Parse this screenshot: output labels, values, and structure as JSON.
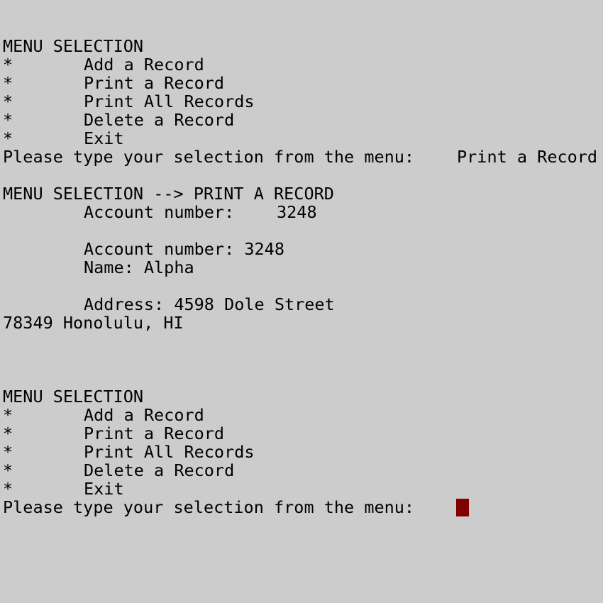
{
  "session1": {
    "menu_title": "MENU SELECTION",
    "bullet": "*",
    "options": [
      "Add a Record",
      "Print a Record",
      "Print All Records",
      "Delete a Record",
      "Exit"
    ],
    "prompt": "Please type your selection from the menu:",
    "user_input": "Print a Record"
  },
  "print_record": {
    "header": "MENU SELECTION --> PRINT A RECORD",
    "account_prompt": "Account number:",
    "account_input": "3248",
    "account_line": "Account number: 3248",
    "name_line": "Name: Alpha",
    "address_line": "Address: 4598 Dole Street",
    "city_line": "78349 Honolulu, HI"
  },
  "session2": {
    "menu_title": "MENU SELECTION",
    "bullet": "*",
    "options": [
      "Add a Record",
      "Print a Record",
      "Print All Records",
      "Delete a Record",
      "Exit"
    ],
    "prompt": "Please type your selection from the menu:"
  },
  "colors": {
    "background": "#cccccc",
    "text": "#000000",
    "cursor": "#800000"
  }
}
